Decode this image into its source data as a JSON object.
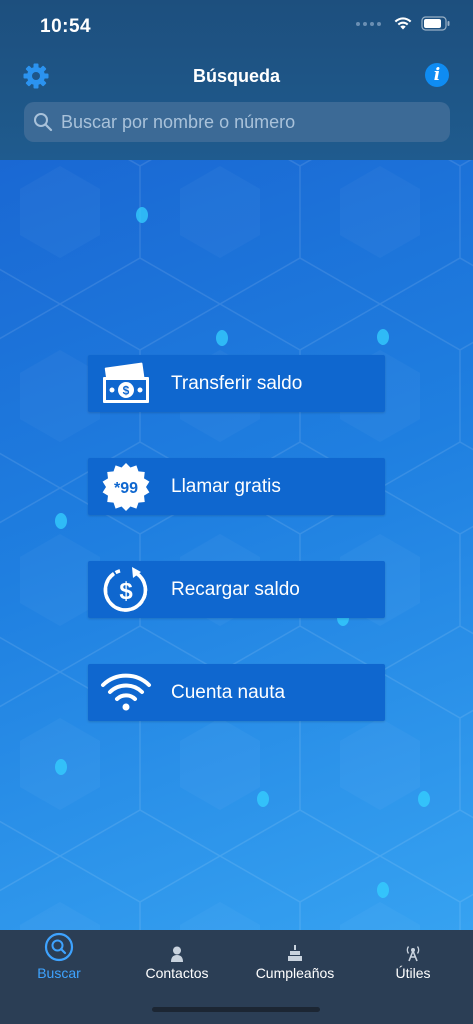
{
  "status_bar": {
    "time": "10:54"
  },
  "header": {
    "title": "Búsqueda",
    "settings_icon": "gear-icon",
    "info_icon": "info-icon",
    "info_glyph": "i"
  },
  "search": {
    "placeholder": "Buscar por nombre o número",
    "value": ""
  },
  "actions": [
    {
      "label": "Transferir saldo",
      "icon": "money-transfer-icon"
    },
    {
      "label": "Llamar gratis",
      "icon": "star99-icon",
      "icon_text": "*99"
    },
    {
      "label": "Recargar saldo",
      "icon": "recharge-icon"
    },
    {
      "label": "Cuenta nauta",
      "icon": "wifi-icon"
    }
  ],
  "tabbar": {
    "active_color": "#3ea3ff",
    "tabs": [
      {
        "label": "Buscar",
        "icon": "search-icon",
        "active": true
      },
      {
        "label": "Contactos",
        "icon": "person-icon",
        "active": false
      },
      {
        "label": "Cumpleaños",
        "icon": "cake-icon",
        "active": false
      },
      {
        "label": "Útiles",
        "icon": "antenna-icon",
        "active": false
      }
    ]
  },
  "colors": {
    "header_bg": "#1f5b8e",
    "button_bg": "#0f67cf",
    "tabbar_bg": "#2b3e55",
    "info_blue": "#0f8cf2"
  }
}
